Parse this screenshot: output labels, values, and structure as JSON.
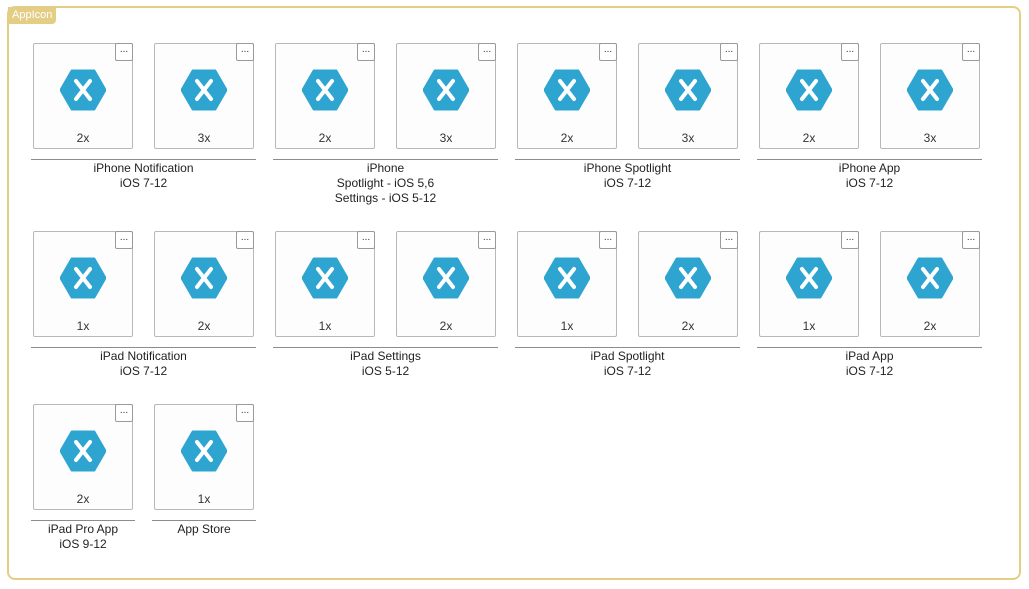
{
  "panel": {
    "title": "AppIcon"
  },
  "menu_glyph": "...",
  "icon": {
    "name": "xamarin-logo-icon",
    "color": "#2ea5d1",
    "glyph_color": "#ffffff"
  },
  "groups": [
    {
      "id": "iphone-notification",
      "title": "iPhone Notification",
      "lines": [
        "iOS 7-12"
      ],
      "scales": [
        "2x",
        "3x"
      ]
    },
    {
      "id": "iphone-spotlight-settings",
      "title": "iPhone",
      "lines": [
        "Spotlight - iOS 5,6",
        "Settings - iOS 5-12"
      ],
      "scales": [
        "2x",
        "3x"
      ]
    },
    {
      "id": "iphone-spotlight",
      "title": "iPhone Spotlight",
      "lines": [
        "iOS 7-12"
      ],
      "scales": [
        "2x",
        "3x"
      ]
    },
    {
      "id": "iphone-app",
      "title": "iPhone App",
      "lines": [
        "iOS 7-12"
      ],
      "scales": [
        "2x",
        "3x"
      ]
    },
    {
      "id": "ipad-notification",
      "title": "iPad Notification",
      "lines": [
        "iOS 7-12"
      ],
      "scales": [
        "1x",
        "2x"
      ]
    },
    {
      "id": "ipad-settings",
      "title": "iPad Settings",
      "lines": [
        "iOS 5-12"
      ],
      "scales": [
        "1x",
        "2x"
      ]
    },
    {
      "id": "ipad-spotlight",
      "title": "iPad Spotlight",
      "lines": [
        "iOS 7-12"
      ],
      "scales": [
        "1x",
        "2x"
      ]
    },
    {
      "id": "ipad-app",
      "title": "iPad App",
      "lines": [
        "iOS 7-12"
      ],
      "scales": [
        "1x",
        "2x"
      ]
    },
    {
      "id": "ipad-pro-app",
      "title": "iPad Pro App",
      "lines": [
        "iOS 9-12"
      ],
      "scales": [
        "2x"
      ]
    },
    {
      "id": "app-store",
      "title": "App Store",
      "lines": [],
      "scales": [
        "1x"
      ]
    }
  ]
}
